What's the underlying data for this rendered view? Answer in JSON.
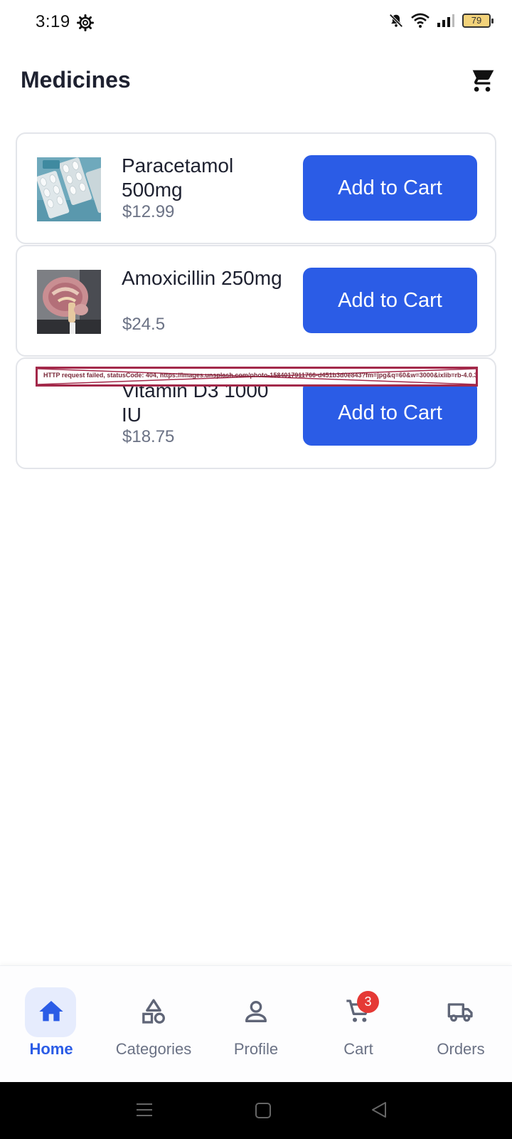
{
  "status_bar": {
    "time": "3:19",
    "battery": "79"
  },
  "header": {
    "title": "Medicines"
  },
  "products": [
    {
      "name": "Paracetamol 500mg",
      "price": "$12.99",
      "button": "Add to Cart",
      "image": "pills-photo"
    },
    {
      "name": "Amoxicillin 250mg",
      "price": "$24.5",
      "button": "Add to Cart",
      "image": "brain-model-photo"
    },
    {
      "name": "Vitamin D3 1000 IU",
      "price": "$18.75",
      "button": "Add to Cart",
      "image": "broken-image"
    }
  ],
  "image_error": {
    "text": "HTTP request failed, statusCode: 404, https://images.unsplash.com/photo-1584017911766-d451b3d0e843?fm=jpg&q=60&w=3000&ixlib=rb-4.0.3"
  },
  "bottom_nav": {
    "items": [
      {
        "label": "Home",
        "icon": "home-icon",
        "active": true
      },
      {
        "label": "Categories",
        "icon": "shapes-icon",
        "active": false
      },
      {
        "label": "Profile",
        "icon": "person-icon",
        "active": false
      },
      {
        "label": "Cart",
        "icon": "cart-icon",
        "active": false
      },
      {
        "label": "Orders",
        "icon": "truck-icon",
        "active": false
      }
    ],
    "cart_badge": "3"
  },
  "colors": {
    "primary": "#2b5ce6",
    "badge": "#e53935",
    "error": "#a3294a"
  }
}
